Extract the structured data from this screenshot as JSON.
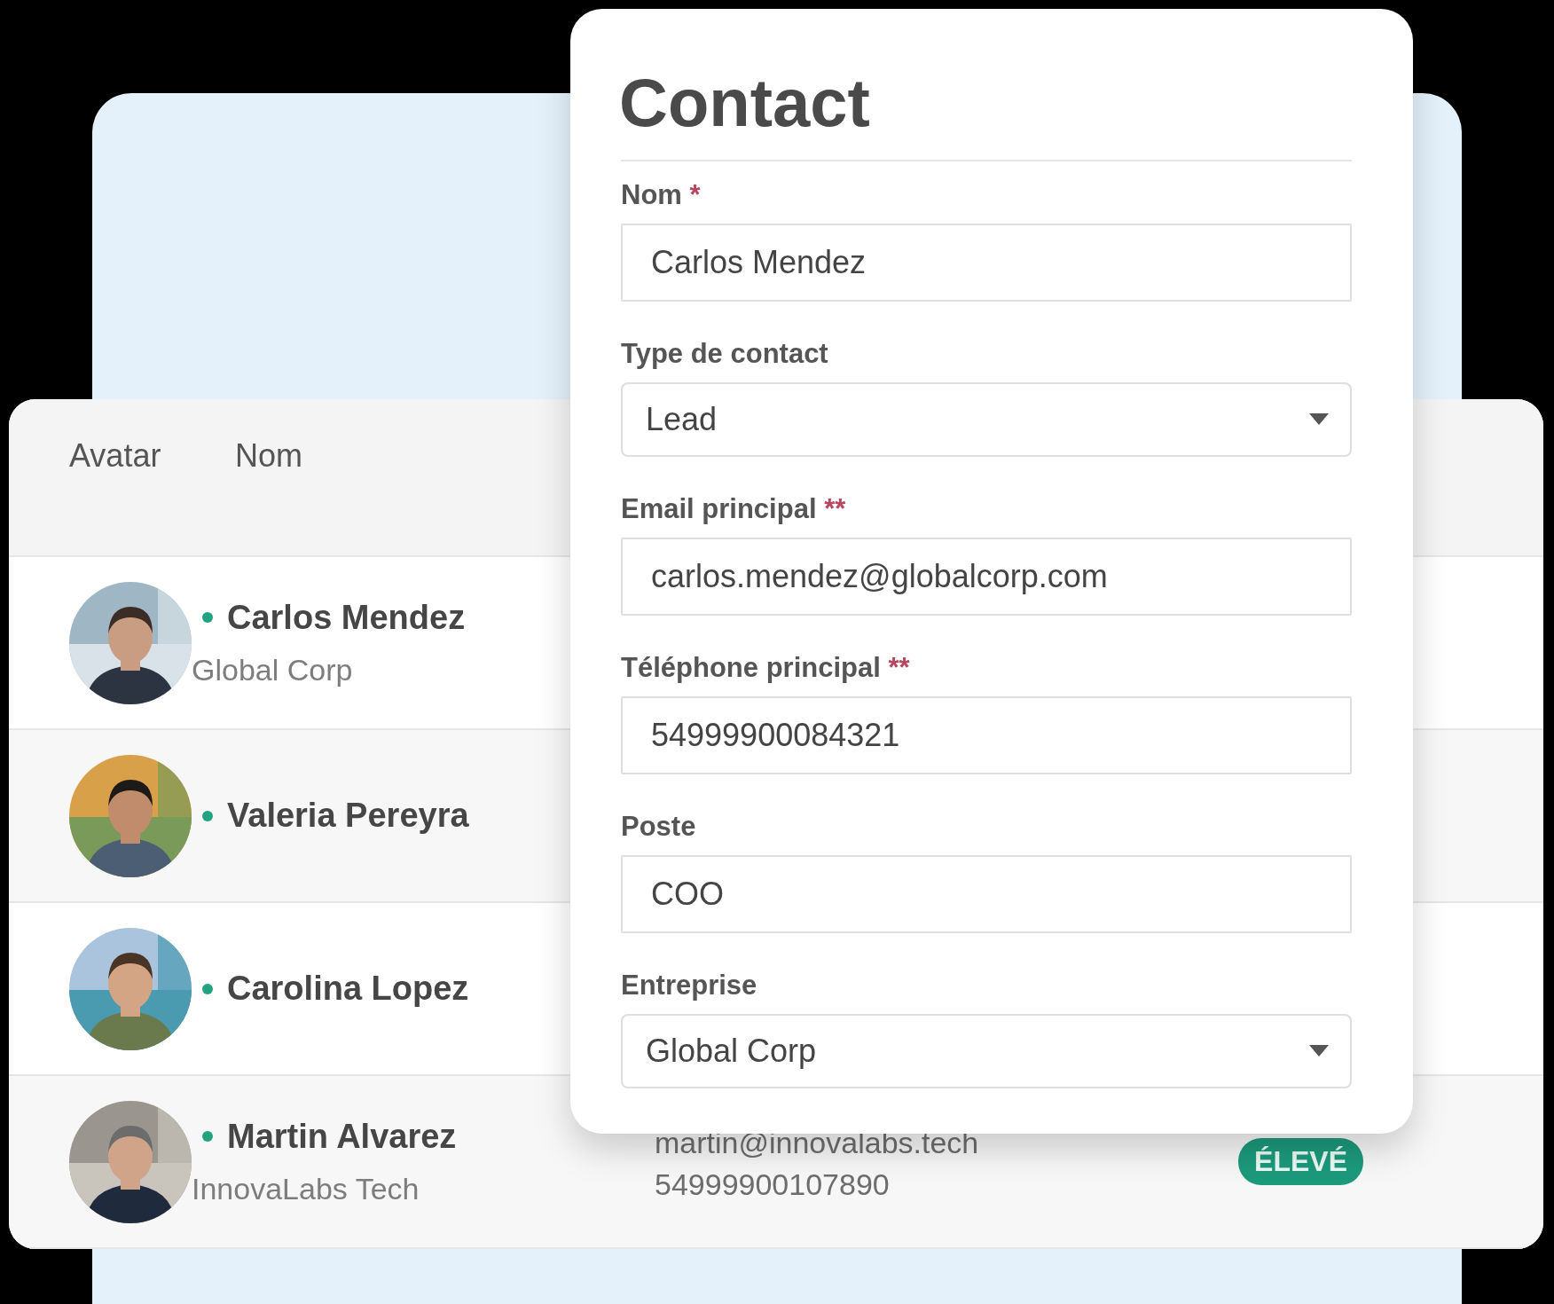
{
  "table": {
    "columns": [
      "Avatar",
      "Nom"
    ],
    "rows": [
      {
        "name": "Carlos Mendez",
        "company": "Global Corp",
        "online": true
      },
      {
        "name": "Valeria Pereyra",
        "online": true
      },
      {
        "name": "Carolina Lopez",
        "online": true
      },
      {
        "name": "Martin Alvarez",
        "company": "InnovaLabs Tech",
        "online": true,
        "email": "martin@innovalabs.tech",
        "phone": "54999900107890",
        "priority": "ÉLEVÉ"
      }
    ]
  },
  "contact_form": {
    "title": "Contact",
    "fields": [
      {
        "label": "Nom",
        "required_marker": "*",
        "kind": "text",
        "value": "Carlos Mendez"
      },
      {
        "label": "Type de contact",
        "kind": "select",
        "value": "Lead"
      },
      {
        "label": "Email principal",
        "required_marker": "**",
        "kind": "text",
        "value": "carlos.mendez@globalcorp.com"
      },
      {
        "label": "Téléphone principal",
        "required_marker": "**",
        "kind": "text",
        "value": "54999900084321"
      },
      {
        "label": "Poste",
        "kind": "text",
        "value": "COO"
      },
      {
        "label": "Entreprise",
        "kind": "select",
        "value": "Global Corp"
      }
    ]
  }
}
